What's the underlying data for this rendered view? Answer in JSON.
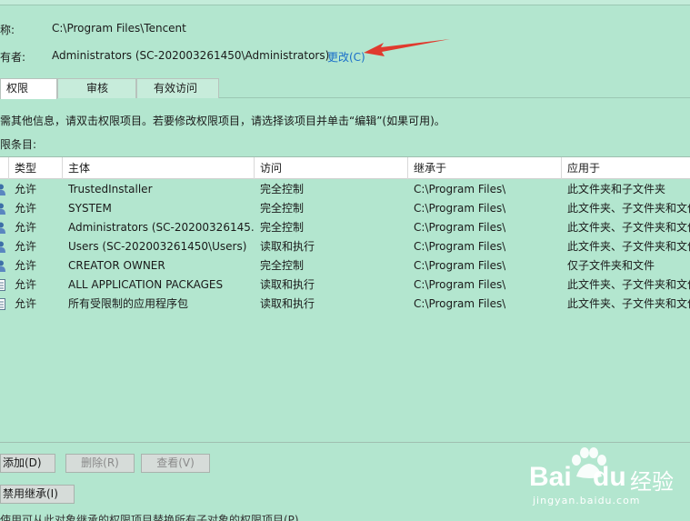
{
  "header": {
    "name_label": "称:",
    "name_value": "C:\\Program Files\\Tencent",
    "owner_label": "有者:",
    "owner_value": "Administrators (SC-202003261450\\Administrators)",
    "change_link": "更改(C)"
  },
  "tabs": [
    {
      "label": "权限",
      "active": true
    },
    {
      "label": "审核",
      "active": false
    },
    {
      "label": "有效访问",
      "active": false
    }
  ],
  "info_text": "需其他信息，请双击权限项目。若要修改权限项目，请选择该项目并单击“编辑”(如果可用)。",
  "entries_label": "限条目:",
  "table": {
    "columns": [
      "类型",
      "主体",
      "访问",
      "继承于",
      "应用于"
    ],
    "rows": [
      {
        "type": "允许",
        "principal": "TrustedInstaller",
        "access": "完全控制",
        "inherited": "C:\\Program Files\\",
        "applies": "此文件夹和子文件夹",
        "icon": "user-icon"
      },
      {
        "type": "允许",
        "principal": "SYSTEM",
        "access": "完全控制",
        "inherited": "C:\\Program Files\\",
        "applies": "此文件夹、子文件夹和文件",
        "icon": "user-icon"
      },
      {
        "type": "允许",
        "principal": "Administrators (SC-20200326145...",
        "access": "完全控制",
        "inherited": "C:\\Program Files\\",
        "applies": "此文件夹、子文件夹和文件",
        "icon": "user-icon"
      },
      {
        "type": "允许",
        "principal": "Users (SC-202003261450\\Users)",
        "access": "读取和执行",
        "inherited": "C:\\Program Files\\",
        "applies": "此文件夹、子文件夹和文件",
        "icon": "user-icon"
      },
      {
        "type": "允许",
        "principal": "CREATOR OWNER",
        "access": "完全控制",
        "inherited": "C:\\Program Files\\",
        "applies": "仅子文件夹和文件",
        "icon": "user-icon"
      },
      {
        "type": "允许",
        "principal": "ALL APPLICATION PACKAGES",
        "access": "读取和执行",
        "inherited": "C:\\Program Files\\",
        "applies": "此文件夹、子文件夹和文件",
        "icon": "package-icon"
      },
      {
        "type": "允许",
        "principal": "所有受限制的应用程序包",
        "access": "读取和执行",
        "inherited": "C:\\Program Files\\",
        "applies": "此文件夹、子文件夹和文件",
        "icon": "package-icon"
      }
    ]
  },
  "buttons": {
    "add": "添加(D)",
    "remove": "删除(R)",
    "view": "查看(V)",
    "disable_inheritance": "禁用继承(I)"
  },
  "footer_text": "使用可从此对象继承的权限项目替换所有子对象的权限项目(P)",
  "watermark": {
    "brand": "Bai",
    "brand_suffix": "du",
    "product": "经验",
    "url": "jingyan.baidu.com"
  },
  "colors": {
    "background": "#b3e6cf",
    "link": "#1a6fc9",
    "arrow": "#e03a2e"
  }
}
